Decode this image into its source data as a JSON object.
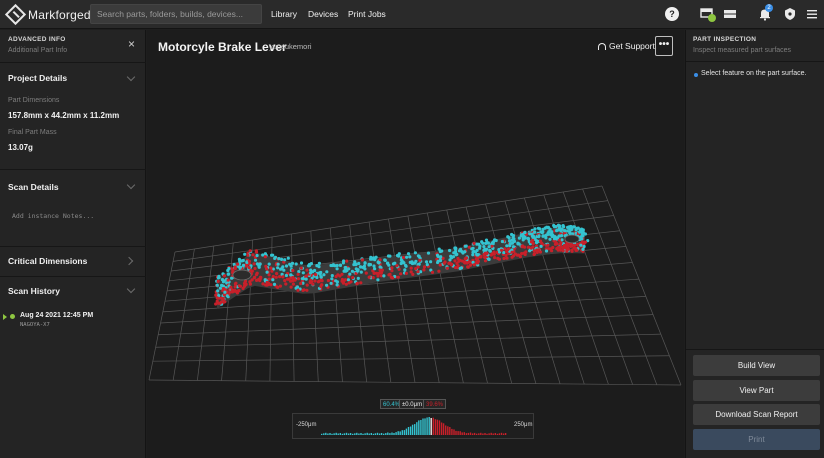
{
  "app": {
    "brand": "Markforged",
    "search_placeholder": "Search parts, folders, builds, devices...",
    "nav": [
      "Library",
      "Devices",
      "Print Jobs"
    ],
    "notification_count": "2"
  },
  "left_panel": {
    "header_title": "ADVANCED INFO",
    "header_subtitle": "Additional Part Info",
    "project_details": {
      "title": "Project Details",
      "dimensions_label": "Part Dimensions",
      "dimensions_value": "157.8mm x 44.2mm x 11.2mm",
      "mass_label": "Final Part Mass",
      "mass_value": "13.07g"
    },
    "scan_details": {
      "title": "Scan Details",
      "notes_placeholder": "Add instance Notes..."
    },
    "critical_dimensions": {
      "title": "Critical Dimensions"
    },
    "scan_history": {
      "title": "Scan History",
      "entries": [
        {
          "date": "Aug 24 2021 12:45 PM",
          "device": "NAGOYA-X7"
        }
      ]
    }
  },
  "main": {
    "part_title": "Motorcyle Brake Lever",
    "author": "yuusukemori",
    "get_support": "Get Support",
    "more_label": "•••",
    "histogram": {
      "in_tolerance_pct": "60.4%",
      "tolerance": "±0.0μm",
      "out_tolerance_pct": "39.6%",
      "min_label": "-250μm",
      "max_label": "250μm"
    }
  },
  "right_panel": {
    "header_title": "PART INSPECTION",
    "header_subtitle": "Inspect measured part surfaces",
    "hint": "Select feature on the part surface.",
    "buttons": [
      "Build View",
      "View Part",
      "Download Scan Report",
      "Print"
    ]
  },
  "colors": {
    "in_tolerance": "#34c3d0",
    "out_tolerance": "#c8202a",
    "accent_green": "#8ec641",
    "accent_blue": "#3a8ee6",
    "print_button": "#3a4a5e"
  },
  "icons": [
    "logo-icon",
    "help-icon",
    "device-status-icon",
    "print-queue-icon",
    "notification-bell-icon",
    "shield-icon",
    "menu-icon",
    "close-icon",
    "headset-icon",
    "more-icon",
    "chevron-down-icon",
    "chevron-right-icon"
  ]
}
